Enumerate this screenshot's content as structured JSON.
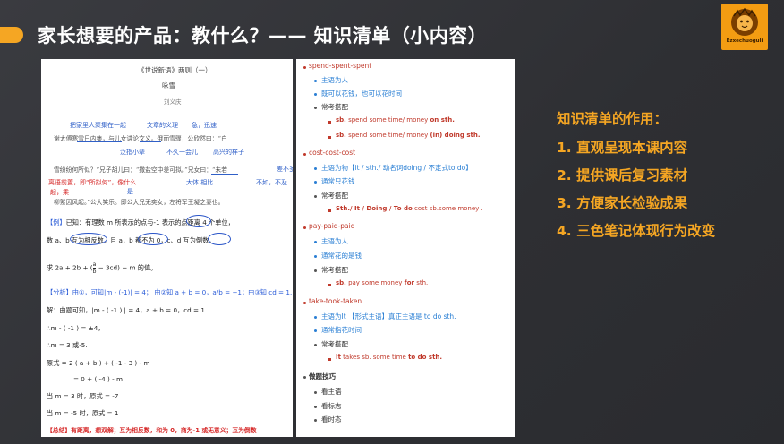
{
  "slide": {
    "title": "家长想要的产品：教什么？—— 知识清单（小内容）",
    "logo_text": "Ezxechuoguli"
  },
  "left_doc": {
    "heading": "《世说新语》两则（一）",
    "subheading": "咏雪",
    "author": "刘义庆",
    "annotations": {
      "a1": "把家里人聚集在一起",
      "a2": "文章的义理",
      "a3": "急，迅速",
      "a4": "泛指小辈",
      "a5": "不久一会儿",
      "a6": "高兴的样子",
      "a7": "差不多",
      "a8": "大体 相比",
      "a9": "不如，不及",
      "a10": "是",
      "red1": "离语前置，即“所拟何”，像什么",
      "red2": "起，乘"
    },
    "classic_lines": {
      "c1": "谢太傅寒雪日内集，与儿女讲论文义。俄而雪骤，公欣然曰：“白",
      "c2": "雪纷纷何所似？”兄子胡儿曰：“撒盐空中差可拟。”兄女曰：“未若",
      "c3": "柳絮因风起。”公大笑乐。即公大兄无奕女，左将军王凝之妻也。"
    },
    "example": {
      "label": "【例】",
      "line1": "已知：有理数 m 所表示的点与-1 表示的点距离 4 个单位，",
      "line2": "数 a、b 互为相反数，且 a，b 都不为 0，c、d 互为倒数。",
      "line3_prefix": "求 2a + 2b + (",
      "line3_frac_num": "a",
      "line3_frac_den": "b",
      "line3_suffix": " − 3cd) − m 的值。"
    },
    "analysis": {
      "label": "【分析】",
      "text": "由①，可知|m - (-1)| = 4；    由②知 a + b = 0，a/b = −1；由③知 cd = 1."
    },
    "solution": [
      "解：由题可知，|m - ( -1 ) | = 4，a + b = 0，cd = 1.",
      "∴m - ( -1 ) = ±4，",
      "∴m = 3 或-5.",
      "原式 = 2 ( a + b ) + ( -1 - 3 ) - m",
      "= 0 + ( -4 ) - m",
      "当 m = 3 时，原式 = -7",
      "当 m = -5 时，原式 = 1"
    ],
    "summary_line": "【总结】有距离，想双解；互为相反数，和为 0，商为-1 或无意义；互为倒数"
  },
  "right_doc": {
    "groups": [
      {
        "head": "spend-spent-spent",
        "items": [
          {
            "text": "主语为人"
          },
          {
            "text": "既可以花钱，也可以花时间"
          },
          {
            "text": "常考搭配"
          }
        ],
        "subitems": [
          {
            "pre": "sb.",
            "mid": " spend  some time/ money ",
            "bold": "on sth."
          },
          {
            "pre": "sb.",
            "mid": " spend  some time/ money ",
            "bold": "(in) doing sth."
          }
        ]
      },
      {
        "head": "cost-cost-cost",
        "items": [
          {
            "text": "主语为物【it / sth./ 动名词doing / 不定式to do】"
          },
          {
            "text": "通常只花钱"
          },
          {
            "text": "常考搭配"
          }
        ],
        "subitems": [
          {
            "pre": "",
            "mid": "",
            "bold": "Sth./ It / Doing / To do",
            "tail": "   cost sb.some money ."
          }
        ]
      },
      {
        "head": "pay-paid-paid",
        "items": [
          {
            "text": "主语为人"
          },
          {
            "text": "通常花的是钱"
          },
          {
            "text": "常考搭配"
          }
        ],
        "subitems": [
          {
            "pre": "sb.",
            "mid": " pay some money ",
            "bold": "for",
            "tail": " sth."
          }
        ]
      },
      {
        "head": "take-took-taken",
        "items": [
          {
            "text": "主语为It 【形式主语】真正主语是 to do sth."
          },
          {
            "text": "通常指花时间"
          },
          {
            "text": "常考搭配"
          }
        ],
        "subitems": [
          {
            "pre": "It",
            "mid": " takes sb.  some time ",
            "bold": "to do sth."
          }
        ]
      }
    ],
    "tips": {
      "head": "做题技巧",
      "items": [
        "看主语",
        "看标志",
        "看时态"
      ]
    }
  },
  "summary_panel": {
    "title": "知识清单的作用：",
    "items": [
      "1. 直观呈现本课内容",
      "2. 提供课后复习素材",
      "3. 方便家长检验成果",
      "4. 三色笔记体现行为改变"
    ]
  },
  "colors": {
    "accent": "#f5a623",
    "background": "#2e2f33",
    "red": "#c0392b",
    "blue": "#2a7fd4"
  }
}
